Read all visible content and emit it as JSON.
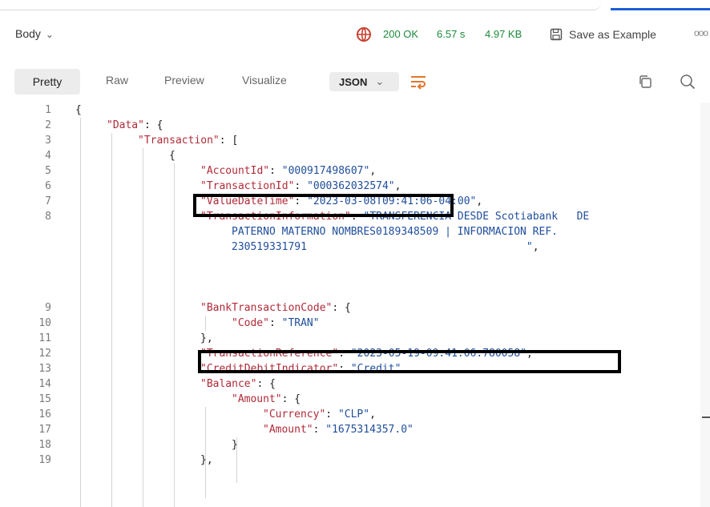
{
  "response_bar": {
    "body_label": "Body",
    "status": "200 OK",
    "time": "6.57 s",
    "size": "4.97 KB",
    "save_label": "Save as Example",
    "more_label": "ooo"
  },
  "view_tabs": {
    "tabs": [
      "Pretty",
      "Raw",
      "Preview",
      "Visualize"
    ],
    "active": "Pretty",
    "format": "JSON"
  },
  "icons": {
    "chevron": "chevron-down-icon",
    "globe": "globe-network-icon",
    "save": "save-icon",
    "wrap": "wrap-lines-icon",
    "copy": "copy-icon",
    "search": "search-icon"
  },
  "colors": {
    "status_green": "#1c8a3b",
    "json_key": "#b02a37",
    "json_string": "#1f4e9c",
    "highlight_box": "#000000"
  },
  "editor": {
    "line_numbers": [
      "1",
      "2",
      "3",
      "4",
      "5",
      "6",
      "7",
      "8",
      "",
      "",
      "9",
      "10",
      "11",
      "12",
      "13",
      "14",
      "15",
      "16",
      "17",
      "18",
      "19"
    ],
    "lines": [
      {
        "k": "",
        "rest": "{"
      },
      {
        "k": "\"Data\"",
        "rest": ": {"
      },
      {
        "k": "\"Transaction\"",
        "rest": ": ["
      },
      {
        "k": "",
        "rest": "{"
      },
      {
        "k": "\"AccountId\"",
        "sep": ": ",
        "s": "\"000917498607\"",
        "rest": ","
      },
      {
        "k": "\"TransactionId\"",
        "sep": ": ",
        "s": "\"000362032574\"",
        "rest": ","
      },
      {
        "k": "\"ValueDateTime\"",
        "sep": ": ",
        "s": "\"2023-03-08T09:41:06-04:00\"",
        "rest": ","
      },
      {
        "k": "\"TransactionInformation\"",
        "sep": ": ",
        "s": "\"TRANSFERENCIA DESDE Scotiabank   DE",
        "rest": ""
      },
      {
        "k": "",
        "s": "PATERNO MATERNO NOMBRES0189348509 | INFORMACION REF.",
        "rest": ""
      },
      {
        "k": "",
        "s": "230519331791                                   \"",
        "rest": ","
      },
      {
        "k": "\"BankTransactionCode\"",
        "rest": ": {"
      },
      {
        "k": "\"Code\"",
        "sep": ": ",
        "s": "\"TRAN\"",
        "rest": ""
      },
      {
        "k": "",
        "rest": "},"
      },
      {
        "k": "\"TransactionReference\"",
        "sep": ": ",
        "s": "\"2023-05-19-09.41.06.780058\"",
        "rest": ","
      },
      {
        "k": "\"CreditDebitIndicator\"",
        "sep": ": ",
        "s": "\"Credit\"",
        "rest": ","
      },
      {
        "k": "\"Balance\"",
        "rest": ": {"
      },
      {
        "k": "\"Amount\"",
        "rest": ": {"
      },
      {
        "k": "\"Currency\"",
        "sep": ": ",
        "s": "\"CLP\"",
        "rest": ","
      },
      {
        "k": "\"Amount\"",
        "sep": ": ",
        "s": "\"1675314357.0\"",
        "rest": ""
      },
      {
        "k": "",
        "rest": "}"
      },
      {
        "k": "",
        "rest": "},"
      }
    ]
  }
}
